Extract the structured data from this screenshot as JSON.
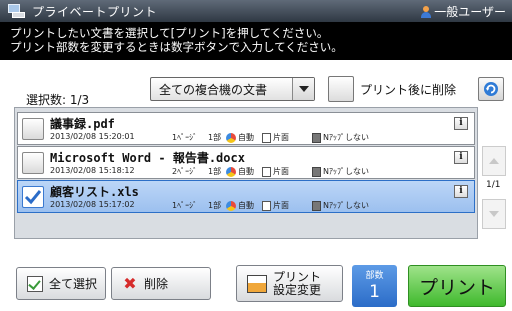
{
  "titlebar": {
    "title": "プライベートプリント",
    "user": "一般ユーザー"
  },
  "instruction": {
    "line1": "プリントしたい文書を選択して[プリント]を押してください。",
    "line2": "プリント部数を変更するときは数字ボタンで入力してください。"
  },
  "toolbar": {
    "selection_count": "選択数: 1/3",
    "filter_value": "全ての複合機の文書",
    "delete_after_print_label": "プリント後に削除",
    "refresh_icon": "refresh-icon"
  },
  "documents": [
    {
      "name": "議事録.pdf",
      "date": "2013/02/08 15:20:01",
      "pages": "1ﾍﾟｰｼﾞ",
      "copies": "1部",
      "color_mode": "自動",
      "sides": "片面",
      "nup": "Nｱｯﾌﾟしない",
      "selected": false
    },
    {
      "name": "Microsoft Word - 報告書.docx",
      "date": "2013/02/08 15:18:12",
      "pages": "2ﾍﾟｰｼﾞ",
      "copies": "1部",
      "color_mode": "自動",
      "sides": "片面",
      "nup": "Nｱｯﾌﾟしない",
      "selected": false
    },
    {
      "name": "顧客リスト.xls",
      "date": "2013/02/08 15:17:02",
      "pages": "1ﾍﾟｰｼﾞ",
      "copies": "1部",
      "color_mode": "自動",
      "sides": "片面",
      "nup": "Nｱｯﾌﾟしない",
      "selected": true
    }
  ],
  "info_label": "i",
  "pager": {
    "page_indicator": "1/1"
  },
  "buttons": {
    "select_all": "全て選択",
    "delete": "削除",
    "settings_line1": "プリント",
    "settings_line2": "設定変更",
    "copies_label": "部数",
    "copies_value": "1",
    "print": "プリント"
  },
  "colors": {
    "selected_row": "#a9c9f2",
    "print_button": "#57c443",
    "copies_box": "#3a7ad6",
    "instruction_bg": "#000000"
  }
}
